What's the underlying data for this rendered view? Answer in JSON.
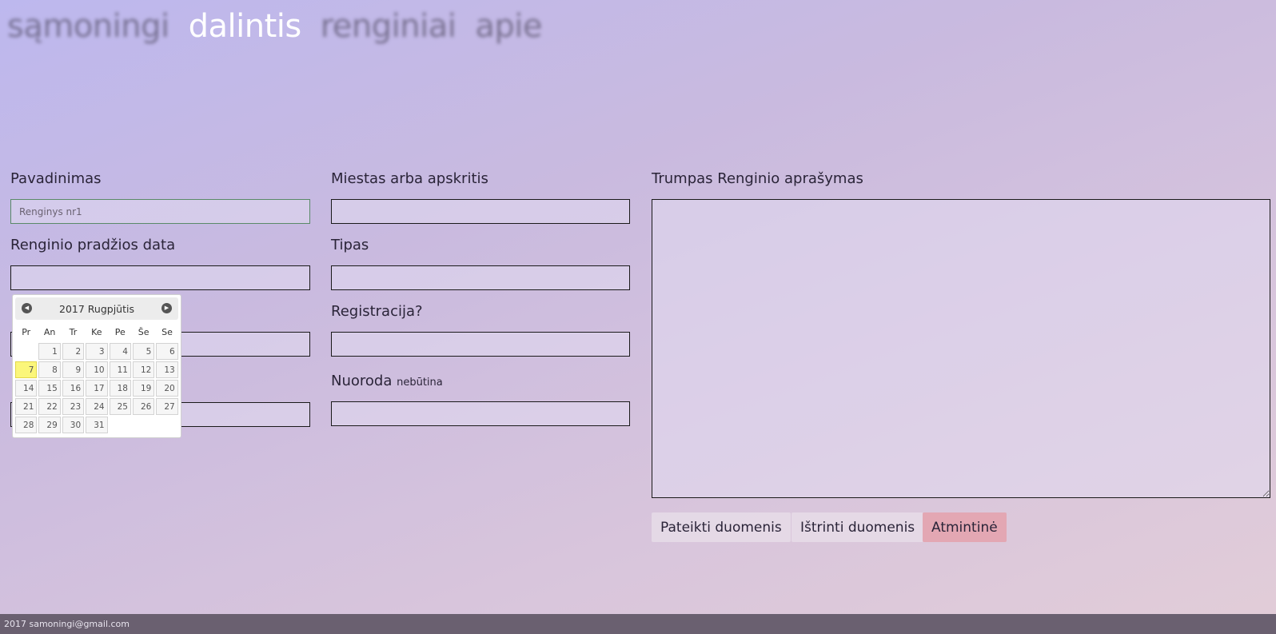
{
  "nav": {
    "items": [
      {
        "label": "sąmoningi",
        "active": false
      },
      {
        "label": "dalintis",
        "active": true
      },
      {
        "label": "renginiai",
        "active": false
      },
      {
        "label": "apie",
        "active": false
      }
    ]
  },
  "form": {
    "title_label": "Pavadinimas",
    "title_placeholder": "Renginys nr1",
    "city_label": "Miestas arba apskritis",
    "description_label": "Trumpas Renginio aprašymas",
    "start_date_label": "Renginio pradžios data",
    "type_label": "Tipas",
    "registration_label": "Registracija?",
    "link_label": "Nuoroda",
    "link_optional": "nebūtina"
  },
  "datepicker": {
    "title": "2017 Rugpjūtis",
    "prev_icon": "prev-arrow-icon",
    "next_icon": "next-arrow-icon",
    "weekdays": [
      "Pr",
      "An",
      "Tr",
      "Ke",
      "Pe",
      "Še",
      "Se"
    ],
    "weeks": [
      [
        "",
        "1",
        "2",
        "3",
        "4",
        "5",
        "6"
      ],
      [
        "7",
        "8",
        "9",
        "10",
        "11",
        "12",
        "13"
      ],
      [
        "14",
        "15",
        "16",
        "17",
        "18",
        "19",
        "20"
      ],
      [
        "21",
        "22",
        "23",
        "24",
        "25",
        "26",
        "27"
      ],
      [
        "28",
        "29",
        "30",
        "31",
        "",
        "",
        ""
      ]
    ],
    "highlighted_day": "7",
    "highlight_color": "#fbf67a"
  },
  "buttons": {
    "submit": "Pateikti duomenis",
    "delete": "Ištrinti duomenis",
    "memo": "Atmintinė",
    "memo_color": "#e3a7b3"
  },
  "footer": {
    "text": "2017 samoningi@gmail.com"
  }
}
